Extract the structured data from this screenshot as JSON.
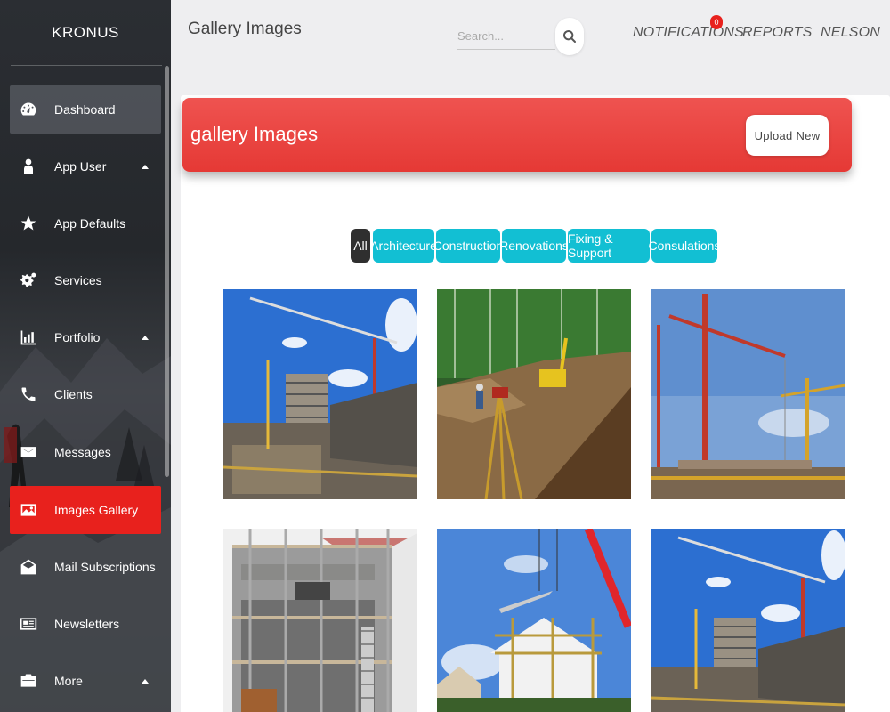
{
  "sidebar": {
    "brand": "KRONUS",
    "items": [
      {
        "label": "Dashboard",
        "icon": "dashboard-gauge-icon"
      },
      {
        "label": "App User",
        "icon": "user-icon"
      },
      {
        "label": "App Defaults",
        "icon": "star-icon"
      },
      {
        "label": "Services",
        "icon": "gears-icon"
      },
      {
        "label": "Portfolio",
        "icon": "bar-chart-icon"
      },
      {
        "label": "Clients",
        "icon": "phone-icon"
      },
      {
        "label": "Messages",
        "icon": "envelope-icon"
      },
      {
        "label": "Images Gallery",
        "icon": "image-icon"
      },
      {
        "label": "Mail Subscriptions",
        "icon": "envelope-open-icon"
      },
      {
        "label": "Newsletters",
        "icon": "newspaper-icon"
      },
      {
        "label": "More",
        "icon": "briefcase-icon"
      }
    ]
  },
  "header": {
    "title": "Gallery Images",
    "search_placeholder": "Search...",
    "notifications": "NOTIFICATIONS",
    "notifications_count": "0",
    "reports": "REPORTS",
    "user": "NELSON"
  },
  "banner": {
    "title": "gallery Images",
    "upload_label": "Upload New"
  },
  "filters": [
    "All",
    "Architecture",
    "Construction",
    "Renovations",
    "Fixing & Support",
    "Consulations"
  ],
  "colors": {
    "accent_red": "#e8211d",
    "banner_red": "#e53935",
    "filter_cyan": "#12bfd3",
    "filter_active": "#2f2f2f"
  }
}
